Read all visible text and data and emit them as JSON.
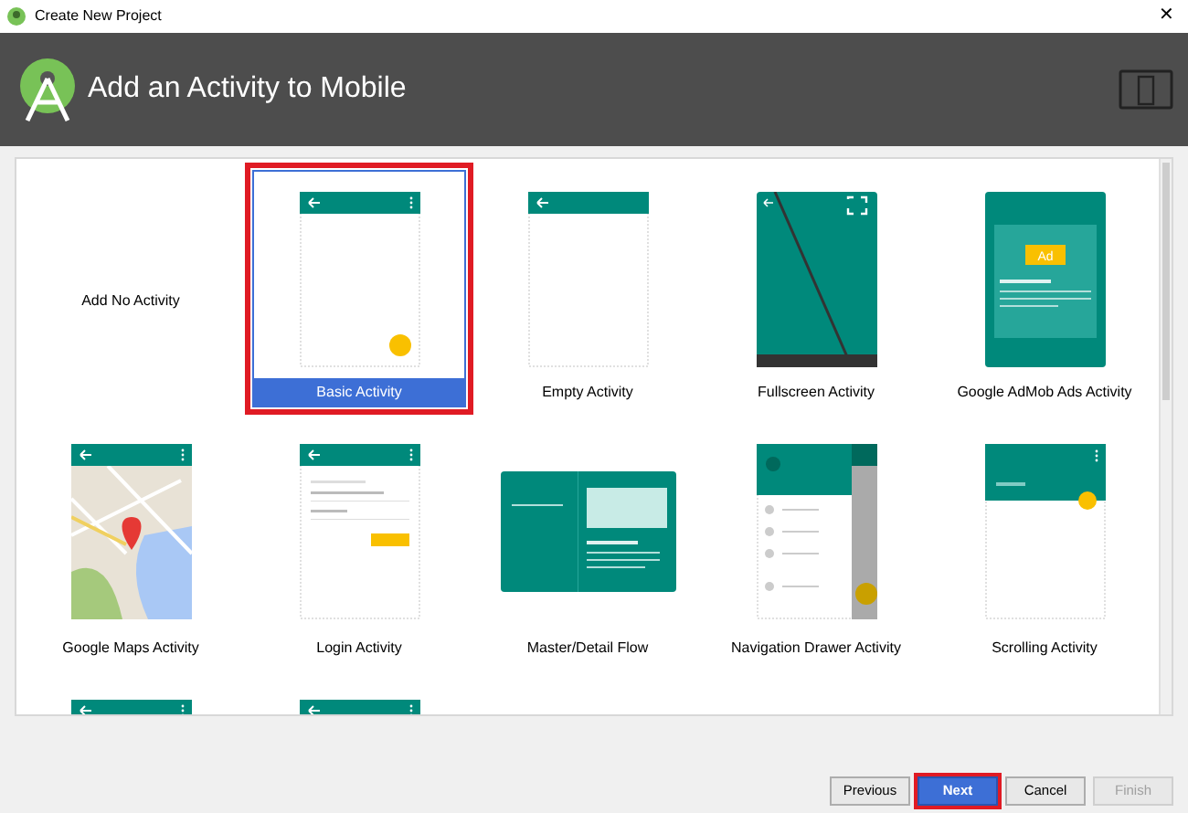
{
  "window": {
    "title": "Create New Project",
    "close": "✕"
  },
  "header": {
    "title": "Add an Activity to Mobile"
  },
  "activities": [
    {
      "kind": "none",
      "label": "Add No Activity",
      "selected": false
    },
    {
      "kind": "basic",
      "label": "Basic Activity",
      "selected": true
    },
    {
      "kind": "empty",
      "label": "Empty Activity",
      "selected": false
    },
    {
      "kind": "fullscreen",
      "label": "Fullscreen Activity",
      "selected": false
    },
    {
      "kind": "admob",
      "label": "Google AdMob Ads Activity",
      "badge": "Ad",
      "selected": false
    },
    {
      "kind": "maps",
      "label": "Google Maps Activity",
      "selected": false
    },
    {
      "kind": "login",
      "label": "Login Activity",
      "selected": false
    },
    {
      "kind": "masterdetail",
      "label": "Master/Detail Flow",
      "selected": false
    },
    {
      "kind": "navdrawer",
      "label": "Navigation Drawer Activity",
      "selected": false
    },
    {
      "kind": "scrolling",
      "label": "Scrolling Activity",
      "selected": false
    },
    {
      "kind": "settings",
      "selected": false
    },
    {
      "kind": "tabbed",
      "selected": false
    }
  ],
  "buttons": [
    {
      "label": "Previous",
      "default": false,
      "disabled": false
    },
    {
      "label": "Next",
      "default": true,
      "disabled": false
    },
    {
      "label": "Cancel",
      "default": false,
      "disabled": false
    },
    {
      "label": "Finish",
      "default": false,
      "disabled": true
    }
  ]
}
